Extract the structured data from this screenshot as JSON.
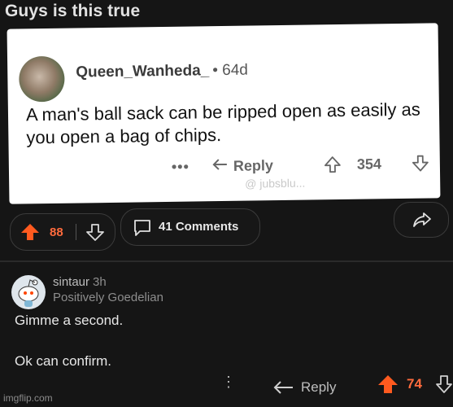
{
  "post": {
    "title": "Guys is this true",
    "score": "88",
    "comments_label": "41 Comments"
  },
  "screenshot": {
    "username": "Queen_Wanheda_",
    "age": "• 64d",
    "text": "A man's ball sack can be ripped open as easily as you open a bag of chips.",
    "dots": "•••",
    "reply_label": "Reply",
    "score": "354",
    "watermark": "@ jubsblu..."
  },
  "comment": {
    "username": "sintaur",
    "time": "3h",
    "flair": "Positively Goedelian",
    "line1": "Gimme a second.",
    "line2": "Ok can confirm.",
    "reply_label": "Reply",
    "score": "74"
  },
  "footer": {
    "watermark": "imgflip.com"
  },
  "colors": {
    "background": "#151515",
    "upvote": "#ff5a1f",
    "score": "#ff6b3d",
    "card": "#ffffff"
  }
}
